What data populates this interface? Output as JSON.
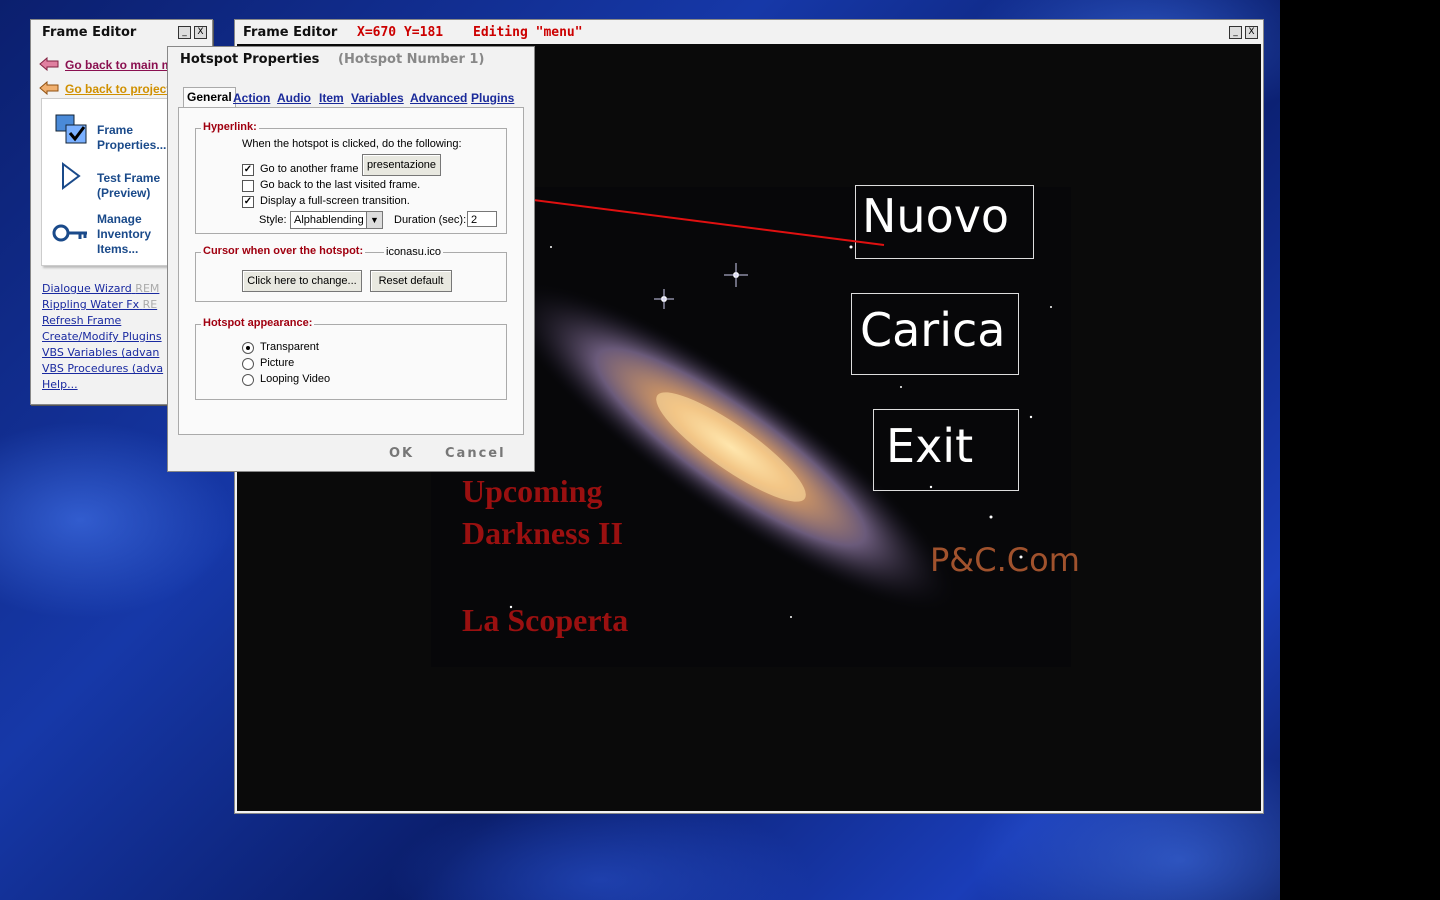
{
  "left_panel": {
    "title": "Frame Editor",
    "minimize": "_",
    "close": "X",
    "link_main": "Go back to main m",
    "link_project": "Go back to project",
    "tools": {
      "frame_properties": "Frame Properties...",
      "test_frame": "Test Frame (Preview)",
      "manage_inventory": "Manage Inventory Items..."
    },
    "links": [
      {
        "label": "Dialogue Wizard",
        "rem": "REM"
      },
      {
        "label": "Rippling Water Fx",
        "rem": "RE"
      },
      {
        "label": "Refresh Frame",
        "rem": ""
      },
      {
        "label": "Create/Modify Plugins",
        "rem": ""
      },
      {
        "label": "VBS Variables (advan",
        "rem": ""
      },
      {
        "label": "VBS Procedures (adva",
        "rem": ""
      },
      {
        "label": "Help...",
        "rem": ""
      }
    ]
  },
  "main_window": {
    "title": "Frame Editor",
    "coords": "X=670 Y=181",
    "editing": "Editing \"menu\"",
    "minimize": "_",
    "close": "X"
  },
  "scene": {
    "buttons": [
      "Nuovo",
      "Carica",
      "Exit"
    ],
    "title_line1": "Upcoming",
    "title_line2": "Darkness II",
    "subtitle": "La Scoperta",
    "brand": "P&C.Com"
  },
  "dialog": {
    "title": "Hotspot Properties",
    "subtitle": "(Hotspot Number 1)",
    "tabs": [
      "General",
      "Action",
      "Audio",
      "Item",
      "Variables",
      "Advanced",
      "Plugins"
    ],
    "active_tab": "General",
    "hyperlink": {
      "label": "Hyperlink:",
      "instruction": "When the hotspot is clicked, do the following:",
      "goto_frame": "Go to another frame",
      "goto_frame_checked": true,
      "goto_frame_value": "presentazione",
      "go_back": "Go back to the last visited frame.",
      "go_back_checked": false,
      "fullscreen": "Display a full-screen transition.",
      "fullscreen_checked": true,
      "style_label": "Style:",
      "style_value": "Alphablending",
      "duration_label": "Duration (sec):",
      "duration_value": "2"
    },
    "cursor": {
      "label": "Cursor when over the hotspot:",
      "file": "iconasu.ico",
      "change_button": "Click here to change...",
      "reset_button": "Reset default"
    },
    "appearance": {
      "label": "Hotspot appearance:",
      "options": [
        "Transparent",
        "Picture",
        "Looping Video"
      ],
      "selected": "Transparent"
    },
    "ok": "OK",
    "cancel": "Cancel"
  },
  "colors": {
    "annotation_arrow": "#e01010",
    "scene_title": "#9a1010",
    "brand": "#a0522d",
    "group_label": "#a00010",
    "coords_text": "#cc0000"
  }
}
